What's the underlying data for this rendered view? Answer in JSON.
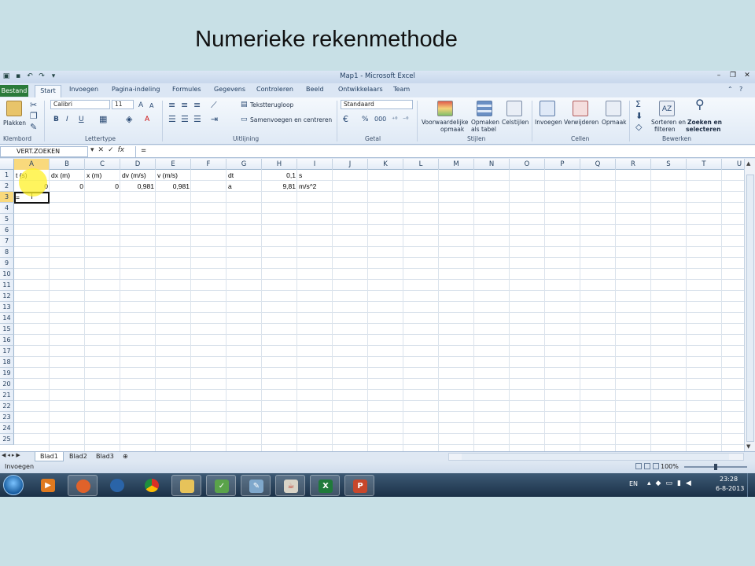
{
  "slide": {
    "title": "Numerieke rekenmethode"
  },
  "window": {
    "title": "Map1 - Microsoft Excel"
  },
  "tabs": [
    "Bestand",
    "Start",
    "Invoegen",
    "Pagina-indeling",
    "Formules",
    "Gegevens",
    "Controleren",
    "Beeld",
    "Ontwikkelaars",
    "Team"
  ],
  "ribbon": {
    "clipboard": {
      "paste": "Plakken",
      "label": "Klembord"
    },
    "font": {
      "name": "Calibri",
      "size": "11",
      "label": "Lettertype",
      "bold": "B",
      "italic": "I",
      "underline": "U"
    },
    "alignment": {
      "wrap": "Tekstterugloop",
      "merge": "Samenvoegen en centreren",
      "label": "Uitlijning"
    },
    "number": {
      "format": "Standaard",
      "percent": "%",
      "thousands": "000",
      "label": "Getal"
    },
    "styles": {
      "conditional": "Voorwaardelijke opmaak",
      "conditional_1": "Voorwaardelijke",
      "conditional_2": "opmaak",
      "table_1": "Opmaken",
      "table_2": "als tabel",
      "cellstyles": "Celstijlen",
      "label": "Stijlen"
    },
    "cells": {
      "insert": "Invoegen",
      "delete": "Verwijderen",
      "format": "Opmaak",
      "label": "Cellen"
    },
    "editing": {
      "sort_1": "Sorteren en",
      "sort_2": "filteren",
      "find_1": "Zoeken en",
      "find_2": "selecteren",
      "label": "Bewerken"
    }
  },
  "formula_bar": {
    "name_box": "VERT.ZOEKEN",
    "content": "="
  },
  "columns": [
    "A",
    "B",
    "C",
    "D",
    "E",
    "F",
    "G",
    "H",
    "I",
    "J",
    "K",
    "L",
    "M",
    "N",
    "O",
    "P",
    "Q",
    "R",
    "S",
    "T",
    "U"
  ],
  "rows": [
    "1",
    "2",
    "3",
    "4",
    "5",
    "6",
    "7",
    "8",
    "9",
    "10",
    "11",
    "12",
    "13",
    "14",
    "15",
    "16",
    "17",
    "18",
    "19",
    "20",
    "21",
    "22",
    "23",
    "24",
    "25"
  ],
  "cells": {
    "A1": "t (s)",
    "B1": "dx (m)",
    "C1": "x (m)",
    "D1": "dv (m/s)",
    "E1": "v (m/s)",
    "G1": "dt",
    "H1": "0,1",
    "I1": "s",
    "A2": "0",
    "B2": "0",
    "C2": "0",
    "D2": "0,981",
    "E2": "0,981",
    "G2": "a",
    "H2": "9,81",
    "I2": "m/s^2",
    "A3": "="
  },
  "active_cell": "A3",
  "sheets": [
    "Blad1",
    "Blad2",
    "Blad3"
  ],
  "status": {
    "mode": "Invoegen",
    "zoom": "100%"
  },
  "taskbar": {
    "apps": [
      "media-player",
      "firefox",
      "thunderbird",
      "chrome",
      "explorer",
      "editor",
      "notepad",
      "java",
      "excel",
      "powerpoint"
    ],
    "lang": "EN",
    "time": "23:28",
    "date": "6-8-2013"
  },
  "colors": {
    "accent": "#2a7a3a",
    "selection": "#f9d97c",
    "cursor_halo": "#fff028"
  }
}
